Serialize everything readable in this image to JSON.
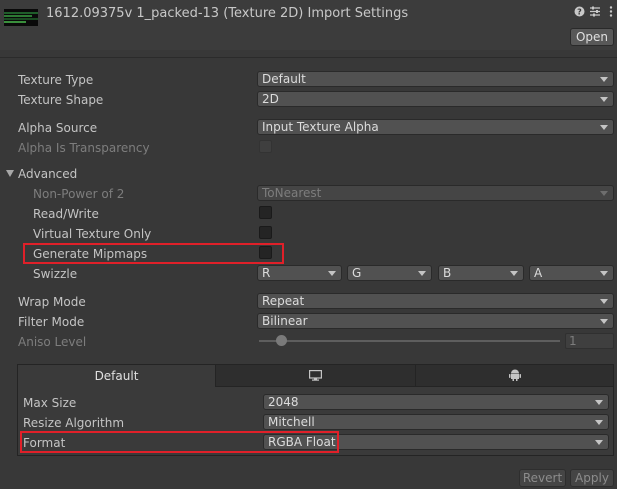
{
  "header": {
    "title": "1612.09375v 1_packed-13 (Texture 2D) Import Settings",
    "icons": [
      "help-icon",
      "preset-icon",
      "more-icon"
    ],
    "open_label": "Open"
  },
  "fields": {
    "texture_type": {
      "label": "Texture Type",
      "value": "Default"
    },
    "texture_shape": {
      "label": "Texture Shape",
      "value": "2D"
    },
    "alpha_source": {
      "label": "Alpha Source",
      "value": "Input Texture Alpha"
    },
    "alpha_is_transparency": {
      "label": "Alpha Is Transparency",
      "checked": false,
      "disabled": true
    },
    "advanced": {
      "label": "Advanced",
      "expanded": true
    },
    "non_power_of_2": {
      "label": "Non-Power of 2",
      "value": "ToNearest",
      "disabled": true
    },
    "read_write": {
      "label": "Read/Write",
      "checked": false
    },
    "virtual_texture_only": {
      "label": "Virtual Texture Only",
      "checked": false
    },
    "generate_mipmaps": {
      "label": "Generate Mipmaps",
      "checked": false
    },
    "swizzle": {
      "label": "Swizzle",
      "values": [
        "R",
        "G",
        "B",
        "A"
      ]
    },
    "wrap_mode": {
      "label": "Wrap Mode",
      "value": "Repeat"
    },
    "filter_mode": {
      "label": "Filter Mode",
      "value": "Bilinear"
    },
    "aniso_level": {
      "label": "Aniso Level",
      "value": "1",
      "disabled": true,
      "level_fraction": 0.0
    }
  },
  "platform": {
    "tabs": [
      {
        "label": "Default",
        "active": true
      },
      {
        "icon": "monitor-icon",
        "active": false
      },
      {
        "icon": "android-icon",
        "active": false
      }
    ],
    "max_size": {
      "label": "Max Size",
      "value": "2048"
    },
    "resize_algorithm": {
      "label": "Resize Algorithm",
      "value": "Mitchell"
    },
    "format": {
      "label": "Format",
      "value": "RGBA Float"
    }
  },
  "footer": {
    "revert_label": "Revert",
    "apply_label": "Apply"
  },
  "colors": {
    "background": "#383838",
    "highlight": "#e02029"
  }
}
